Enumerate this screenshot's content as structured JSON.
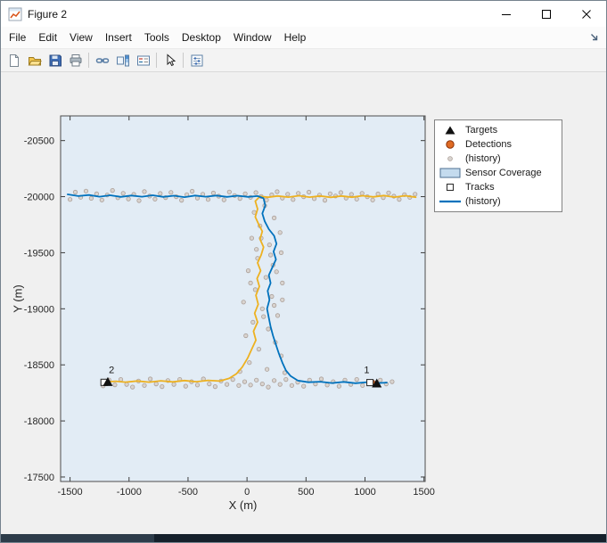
{
  "window": {
    "title": "Figure 2"
  },
  "menu": {
    "items": [
      "File",
      "Edit",
      "View",
      "Insert",
      "Tools",
      "Desktop",
      "Window",
      "Help"
    ]
  },
  "toolbar": {
    "buttons": [
      "new-figure",
      "open-file",
      "save-figure",
      "print-figure",
      "link-plot",
      "insert-colorbar",
      "insert-legend",
      "edit-plot",
      "property-inspector"
    ]
  },
  "chart_data": {
    "type": "line",
    "title": "",
    "xlabel": "X (m)",
    "ylabel": "Y (m)",
    "xlim": [
      -1580,
      1510
    ],
    "ylim": [
      -20720,
      -17460
    ],
    "y_direction": "reverse",
    "x_ticks": [
      -1500,
      -1000,
      -500,
      0,
      500,
      1000,
      1500
    ],
    "y_ticks": [
      -20500,
      -20000,
      -19500,
      -19000,
      -18500,
      -18000,
      -17500
    ],
    "grid": false,
    "legend_location": "outside-right-top",
    "legend": [
      "Targets",
      "Detections",
      "(history)",
      "Sensor Coverage",
      "Tracks",
      "(history)"
    ],
    "colors": {
      "axes_bg": "#e2ecf5",
      "figure_bg": "#f0f0f0",
      "track1": "#0072BD",
      "track2": "#EDB120",
      "detection": "#df6b24",
      "detection_history": "#d9d4d0"
    },
    "series": [
      {
        "id": "detection-history-dot",
        "name": "Detections (history)",
        "kind": "scatter",
        "size": 2.2,
        "fill": "#d9d4d0",
        "edge": "#ab9f98",
        "points": [
          [
            -1500,
            -19975
          ],
          [
            -1455,
            -20040
          ],
          [
            -1410,
            -19995
          ],
          [
            -1365,
            -20050
          ],
          [
            -1320,
            -19985
          ],
          [
            -1275,
            -20025
          ],
          [
            -1230,
            -19970
          ],
          [
            -1185,
            -20015
          ],
          [
            -1140,
            -20055
          ],
          [
            -1095,
            -19990
          ],
          [
            -1050,
            -20030
          ],
          [
            -1005,
            -19980
          ],
          [
            -960,
            -20020
          ],
          [
            -915,
            -19965
          ],
          [
            -870,
            -20045
          ],
          [
            -825,
            -20005
          ],
          [
            -780,
            -19978
          ],
          [
            -735,
            -20028
          ],
          [
            -690,
            -19992
          ],
          [
            -645,
            -20038
          ],
          [
            -600,
            -20000
          ],
          [
            -555,
            -19968
          ],
          [
            -510,
            -20018
          ],
          [
            -465,
            -20048
          ],
          [
            -420,
            -19988
          ],
          [
            -375,
            -20022
          ],
          [
            -330,
            -19975
          ],
          [
            -285,
            -20032
          ],
          [
            -240,
            -20004
          ],
          [
            -195,
            -19972
          ],
          [
            -150,
            -20042
          ],
          [
            -105,
            -20010
          ],
          [
            -60,
            -19984
          ],
          [
            -15,
            -20026
          ],
          [
            30,
            -19994
          ],
          [
            75,
            -20036
          ],
          [
            120,
            -20002
          ],
          [
            165,
            -19970
          ],
          [
            210,
            -20016
          ],
          [
            255,
            -20044
          ],
          [
            300,
            -19988
          ],
          [
            345,
            -20022
          ],
          [
            390,
            -19974
          ],
          [
            435,
            -20030
          ],
          [
            480,
            -20000
          ],
          [
            525,
            -20040
          ],
          [
            570,
            -19982
          ],
          [
            615,
            -20014
          ],
          [
            660,
            -19968
          ],
          [
            705,
            -20026
          ],
          [
            750,
            -20006
          ],
          [
            795,
            -20036
          ],
          [
            840,
            -19988
          ],
          [
            885,
            -20020
          ],
          [
            930,
            -19978
          ],
          [
            975,
            -20030
          ],
          [
            1020,
            -20000
          ],
          [
            1065,
            -19970
          ],
          [
            1110,
            -20024
          ],
          [
            1155,
            -19992
          ],
          [
            1200,
            -20034
          ],
          [
            1245,
            -20004
          ],
          [
            1290,
            -19976
          ],
          [
            1335,
            -20018
          ],
          [
            1380,
            -19994
          ],
          [
            1425,
            -20022
          ],
          [
            -1220,
            -18312
          ],
          [
            -1170,
            -18365
          ],
          [
            -1120,
            -18322
          ],
          [
            -1070,
            -18370
          ],
          [
            -1020,
            -18326
          ],
          [
            -970,
            -18302
          ],
          [
            -920,
            -18356
          ],
          [
            -870,
            -18316
          ],
          [
            -820,
            -18374
          ],
          [
            -770,
            -18330
          ],
          [
            -720,
            -18306
          ],
          [
            -670,
            -18360
          ],
          [
            -620,
            -18326
          ],
          [
            -570,
            -18370
          ],
          [
            -520,
            -18310
          ],
          [
            -470,
            -18350
          ],
          [
            -420,
            -18320
          ],
          [
            -370,
            -18374
          ],
          [
            -320,
            -18330
          ],
          [
            -270,
            -18306
          ],
          [
            -220,
            -18356
          ],
          [
            -170,
            -18326
          ],
          [
            -120,
            -18370
          ],
          [
            -70,
            -18316
          ],
          [
            -20,
            -18350
          ],
          [
            30,
            -18320
          ],
          [
            80,
            -18364
          ],
          [
            130,
            -18330
          ],
          [
            180,
            -18302
          ],
          [
            230,
            -18360
          ],
          [
            280,
            -18326
          ],
          [
            330,
            -18370
          ],
          [
            380,
            -18316
          ],
          [
            430,
            -18346
          ],
          [
            480,
            -18310
          ],
          [
            530,
            -18364
          ],
          [
            580,
            -18330
          ],
          [
            630,
            -18374
          ],
          [
            680,
            -18320
          ],
          [
            730,
            -18350
          ],
          [
            780,
            -18310
          ],
          [
            830,
            -18364
          ],
          [
            880,
            -18326
          ],
          [
            930,
            -18370
          ],
          [
            980,
            -18316
          ],
          [
            1030,
            -18346
          ],
          [
            1080,
            -18320
          ],
          [
            1130,
            -18364
          ],
          [
            1180,
            -18330
          ],
          [
            1230,
            -18350
          ],
          [
            150,
            -19920
          ],
          [
            60,
            -19860
          ],
          [
            230,
            -19810
          ],
          [
            110,
            -19740
          ],
          [
            280,
            -19680
          ],
          [
            40,
            -19630
          ],
          [
            190,
            -19570
          ],
          [
            290,
            -19500
          ],
          [
            90,
            -19450
          ],
          [
            220,
            -19390
          ],
          [
            10,
            -19340
          ],
          [
            160,
            -19280
          ],
          [
            300,
            -19230
          ],
          [
            70,
            -19170
          ],
          [
            210,
            -19110
          ],
          [
            -30,
            -19060
          ],
          [
            130,
            -19000
          ],
          [
            260,
            -18940
          ],
          [
            50,
            -18880
          ],
          [
            180,
            -18820
          ],
          [
            -10,
            -18760
          ],
          [
            240,
            -18700
          ],
          [
            100,
            -18640
          ],
          [
            290,
            -18580
          ],
          [
            20,
            -18520
          ],
          [
            170,
            -18460
          ],
          [
            320,
            -18430
          ],
          [
            -60,
            -18440
          ],
          [
            200,
            -19480
          ],
          [
            120,
            -19630
          ],
          [
            250,
            -19330
          ],
          [
            80,
            -19530
          ],
          [
            300,
            -19080
          ],
          [
            140,
            -18930
          ],
          [
            230,
            -19030
          ],
          [
            30,
            -19230
          ]
        ]
      },
      {
        "id": "track2-history-line",
        "name": "Track 2 (history)",
        "kind": "line",
        "color": "#EDB120",
        "width": 1.8,
        "points": [
          [
            1430,
            -19995
          ],
          [
            1340,
            -20008
          ],
          [
            1250,
            -19996
          ],
          [
            1160,
            -20010
          ],
          [
            1070,
            -19998
          ],
          [
            980,
            -20008
          ],
          [
            890,
            -19995
          ],
          [
            800,
            -20006
          ],
          [
            710,
            -19994
          ],
          [
            620,
            -20006
          ],
          [
            530,
            -19996
          ],
          [
            440,
            -20008
          ],
          [
            350,
            -19996
          ],
          [
            260,
            -20006
          ],
          [
            180,
            -19995
          ],
          [
            110,
            -20002
          ],
          [
            70,
            -19960
          ],
          [
            90,
            -19890
          ],
          [
            70,
            -19820
          ],
          [
            100,
            -19750
          ],
          [
            130,
            -19690
          ],
          [
            110,
            -19620
          ],
          [
            140,
            -19550
          ],
          [
            120,
            -19480
          ],
          [
            90,
            -19410
          ],
          [
            115,
            -19340
          ],
          [
            85,
            -19270
          ],
          [
            105,
            -19200
          ],
          [
            75,
            -19120
          ],
          [
            95,
            -19040
          ],
          [
            65,
            -18960
          ],
          [
            90,
            -18880
          ],
          [
            55,
            -18800
          ],
          [
            75,
            -18720
          ],
          [
            40,
            -18640
          ],
          [
            5,
            -18560
          ],
          [
            -40,
            -18480
          ],
          [
            -90,
            -18420
          ],
          [
            -150,
            -18380
          ],
          [
            -230,
            -18355
          ],
          [
            -330,
            -18362
          ],
          [
            -430,
            -18350
          ],
          [
            -530,
            -18360
          ],
          [
            -630,
            -18348
          ],
          [
            -730,
            -18358
          ],
          [
            -830,
            -18346
          ],
          [
            -930,
            -18356
          ],
          [
            -1030,
            -18346
          ],
          [
            -1110,
            -18354
          ],
          [
            -1180,
            -18350
          ]
        ]
      },
      {
        "id": "track1-history-line",
        "name": "Track 1 (history)",
        "kind": "line",
        "color": "#0072BD",
        "width": 1.8,
        "points": [
          [
            -1520,
            -20020
          ],
          [
            -1430,
            -20005
          ],
          [
            -1340,
            -20015
          ],
          [
            -1250,
            -20000
          ],
          [
            -1160,
            -20012
          ],
          [
            -1070,
            -19998
          ],
          [
            -980,
            -20010
          ],
          [
            -890,
            -20000
          ],
          [
            -800,
            -20012
          ],
          [
            -710,
            -19998
          ],
          [
            -620,
            -20008
          ],
          [
            -530,
            -19996
          ],
          [
            -440,
            -20010
          ],
          [
            -350,
            -20000
          ],
          [
            -260,
            -20010
          ],
          [
            -170,
            -19998
          ],
          [
            -80,
            -20008
          ],
          [
            10,
            -19998
          ],
          [
            90,
            -20005
          ],
          [
            140,
            -19985
          ],
          [
            155,
            -19920
          ],
          [
            130,
            -19850
          ],
          [
            150,
            -19780
          ],
          [
            185,
            -19710
          ],
          [
            230,
            -19650
          ],
          [
            250,
            -19580
          ],
          [
            225,
            -19510
          ],
          [
            245,
            -19440
          ],
          [
            215,
            -19370
          ],
          [
            185,
            -19300
          ],
          [
            200,
            -19230
          ],
          [
            175,
            -19160
          ],
          [
            190,
            -19080
          ],
          [
            170,
            -19000
          ],
          [
            185,
            -18920
          ],
          [
            200,
            -18840
          ],
          [
            220,
            -18760
          ],
          [
            245,
            -18680
          ],
          [
            270,
            -18600
          ],
          [
            300,
            -18520
          ],
          [
            330,
            -18450
          ],
          [
            370,
            -18400
          ],
          [
            430,
            -18360
          ],
          [
            520,
            -18345
          ],
          [
            620,
            -18350
          ],
          [
            720,
            -18338
          ],
          [
            820,
            -18348
          ],
          [
            920,
            -18336
          ],
          [
            1020,
            -18346
          ],
          [
            1110,
            -18338
          ],
          [
            1185,
            -18342
          ]
        ]
      },
      {
        "id": "detection-dot",
        "name": "Detections",
        "kind": "scatter",
        "size": 3.0,
        "fill": "#df6b24",
        "edge": "#8a3108",
        "points": [
          [
            1062,
            -18342
          ],
          [
            -1196,
            -18348
          ]
        ]
      },
      {
        "id": "track-marker",
        "name": "Tracks",
        "kind": "square",
        "size": 7,
        "fill": "#ffffff",
        "edge": "#333333",
        "points": [
          [
            1042,
            -18342
          ],
          [
            -1212,
            -18344
          ]
        ]
      },
      {
        "id": "target-marker",
        "name": "Targets",
        "kind": "triangle",
        "size": 11,
        "fill": "#111111",
        "points": [
          [
            1100,
            -18335
          ],
          [
            -1180,
            -18348
          ]
        ]
      }
    ],
    "annotations": [
      {
        "text": "1",
        "x": 1015,
        "y": -18425
      },
      {
        "text": "2",
        "x": -1148,
        "y": -18425
      }
    ]
  }
}
